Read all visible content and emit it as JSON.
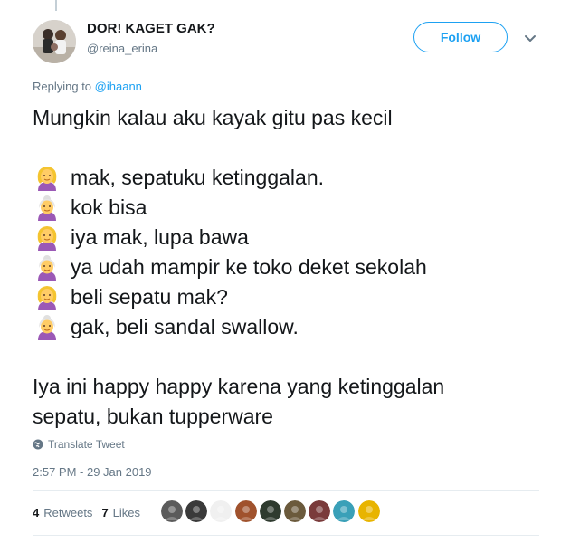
{
  "author": {
    "name": "DOR! KAGET GAK?",
    "handle": "@reina_erina"
  },
  "follow_label": "Follow",
  "reply": {
    "prefix": "Replying to",
    "mention": "@ihaann"
  },
  "tweet": {
    "intro": "Mungkin kalau aku kayak gitu pas kecil",
    "dialog": [
      {
        "speaker": "child",
        "emoji": "woman-yellow-hair-icon",
        "text": "mak, sepatuku ketinggalan."
      },
      {
        "speaker": "mother",
        "emoji": "old-woman-icon",
        "text": "kok bisa"
      },
      {
        "speaker": "child",
        "emoji": "woman-yellow-hair-icon",
        "text": "iya mak, lupa bawa"
      },
      {
        "speaker": "mother",
        "emoji": "old-woman-icon",
        "text": "ya udah mampir ke toko deket sekolah"
      },
      {
        "speaker": "child",
        "emoji": "woman-yellow-hair-icon",
        "text": "beli sepatu mak?"
      },
      {
        "speaker": "mother",
        "emoji": "old-woman-icon",
        "text": "gak, beli sandal swallow."
      }
    ],
    "outro_line1": "Iya ini happy happy karena yang ketinggalan",
    "outro_line2": "sepatu, bukan tupperware"
  },
  "translate_label": "Translate Tweet",
  "timestamp": "2:57 PM - 29 Jan 2019",
  "stats": {
    "retweets_count": "4",
    "retweets_label": "Retweets",
    "likes_count": "7",
    "likes_label": "Likes"
  },
  "colors": {
    "accent": "#1da1f2",
    "muted": "#657786",
    "text": "#14171a"
  },
  "liker_avatars": [
    {
      "color": "#5b5b5b"
    },
    {
      "color": "#3a3a3a"
    },
    {
      "color": "#f0f0f0"
    },
    {
      "color": "#a0522d"
    },
    {
      "color": "#2f3b2f"
    },
    {
      "color": "#6b5a3c"
    },
    {
      "color": "#7a3b3b"
    },
    {
      "color": "#3aa0b8"
    },
    {
      "color": "#e8b400"
    }
  ]
}
